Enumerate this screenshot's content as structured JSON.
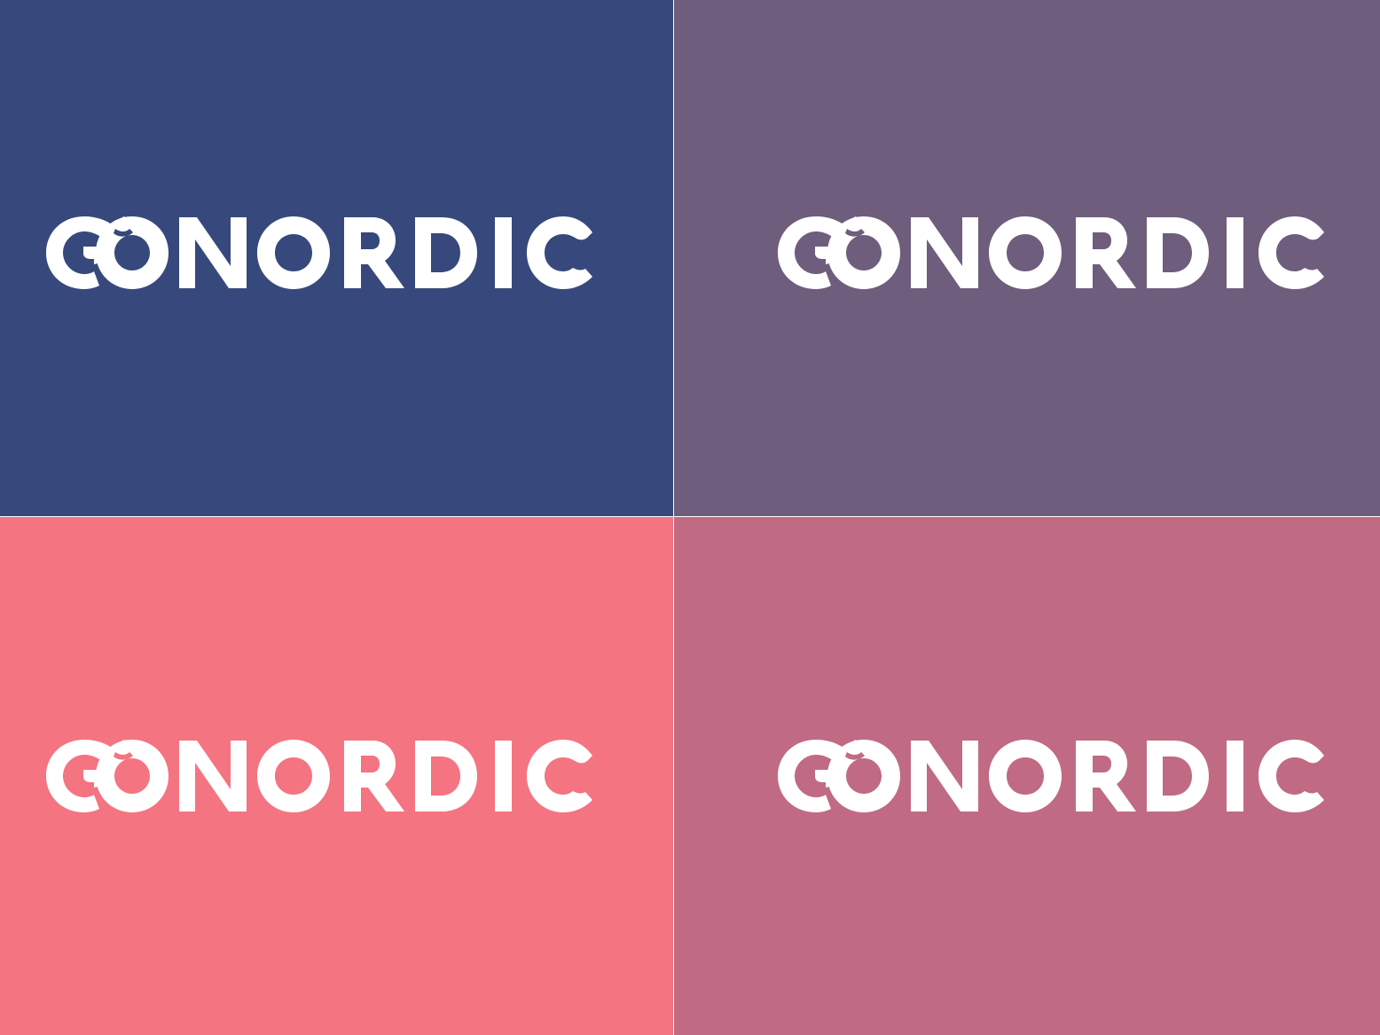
{
  "brand": {
    "wordmark": "GONORDIC"
  },
  "panels": [
    {
      "background": "#37497c"
    },
    {
      "background": "#6e5d7d"
    },
    {
      "background": "#f47481"
    },
    {
      "background": "#c06b83"
    }
  ],
  "logo_color": "#ffffff"
}
